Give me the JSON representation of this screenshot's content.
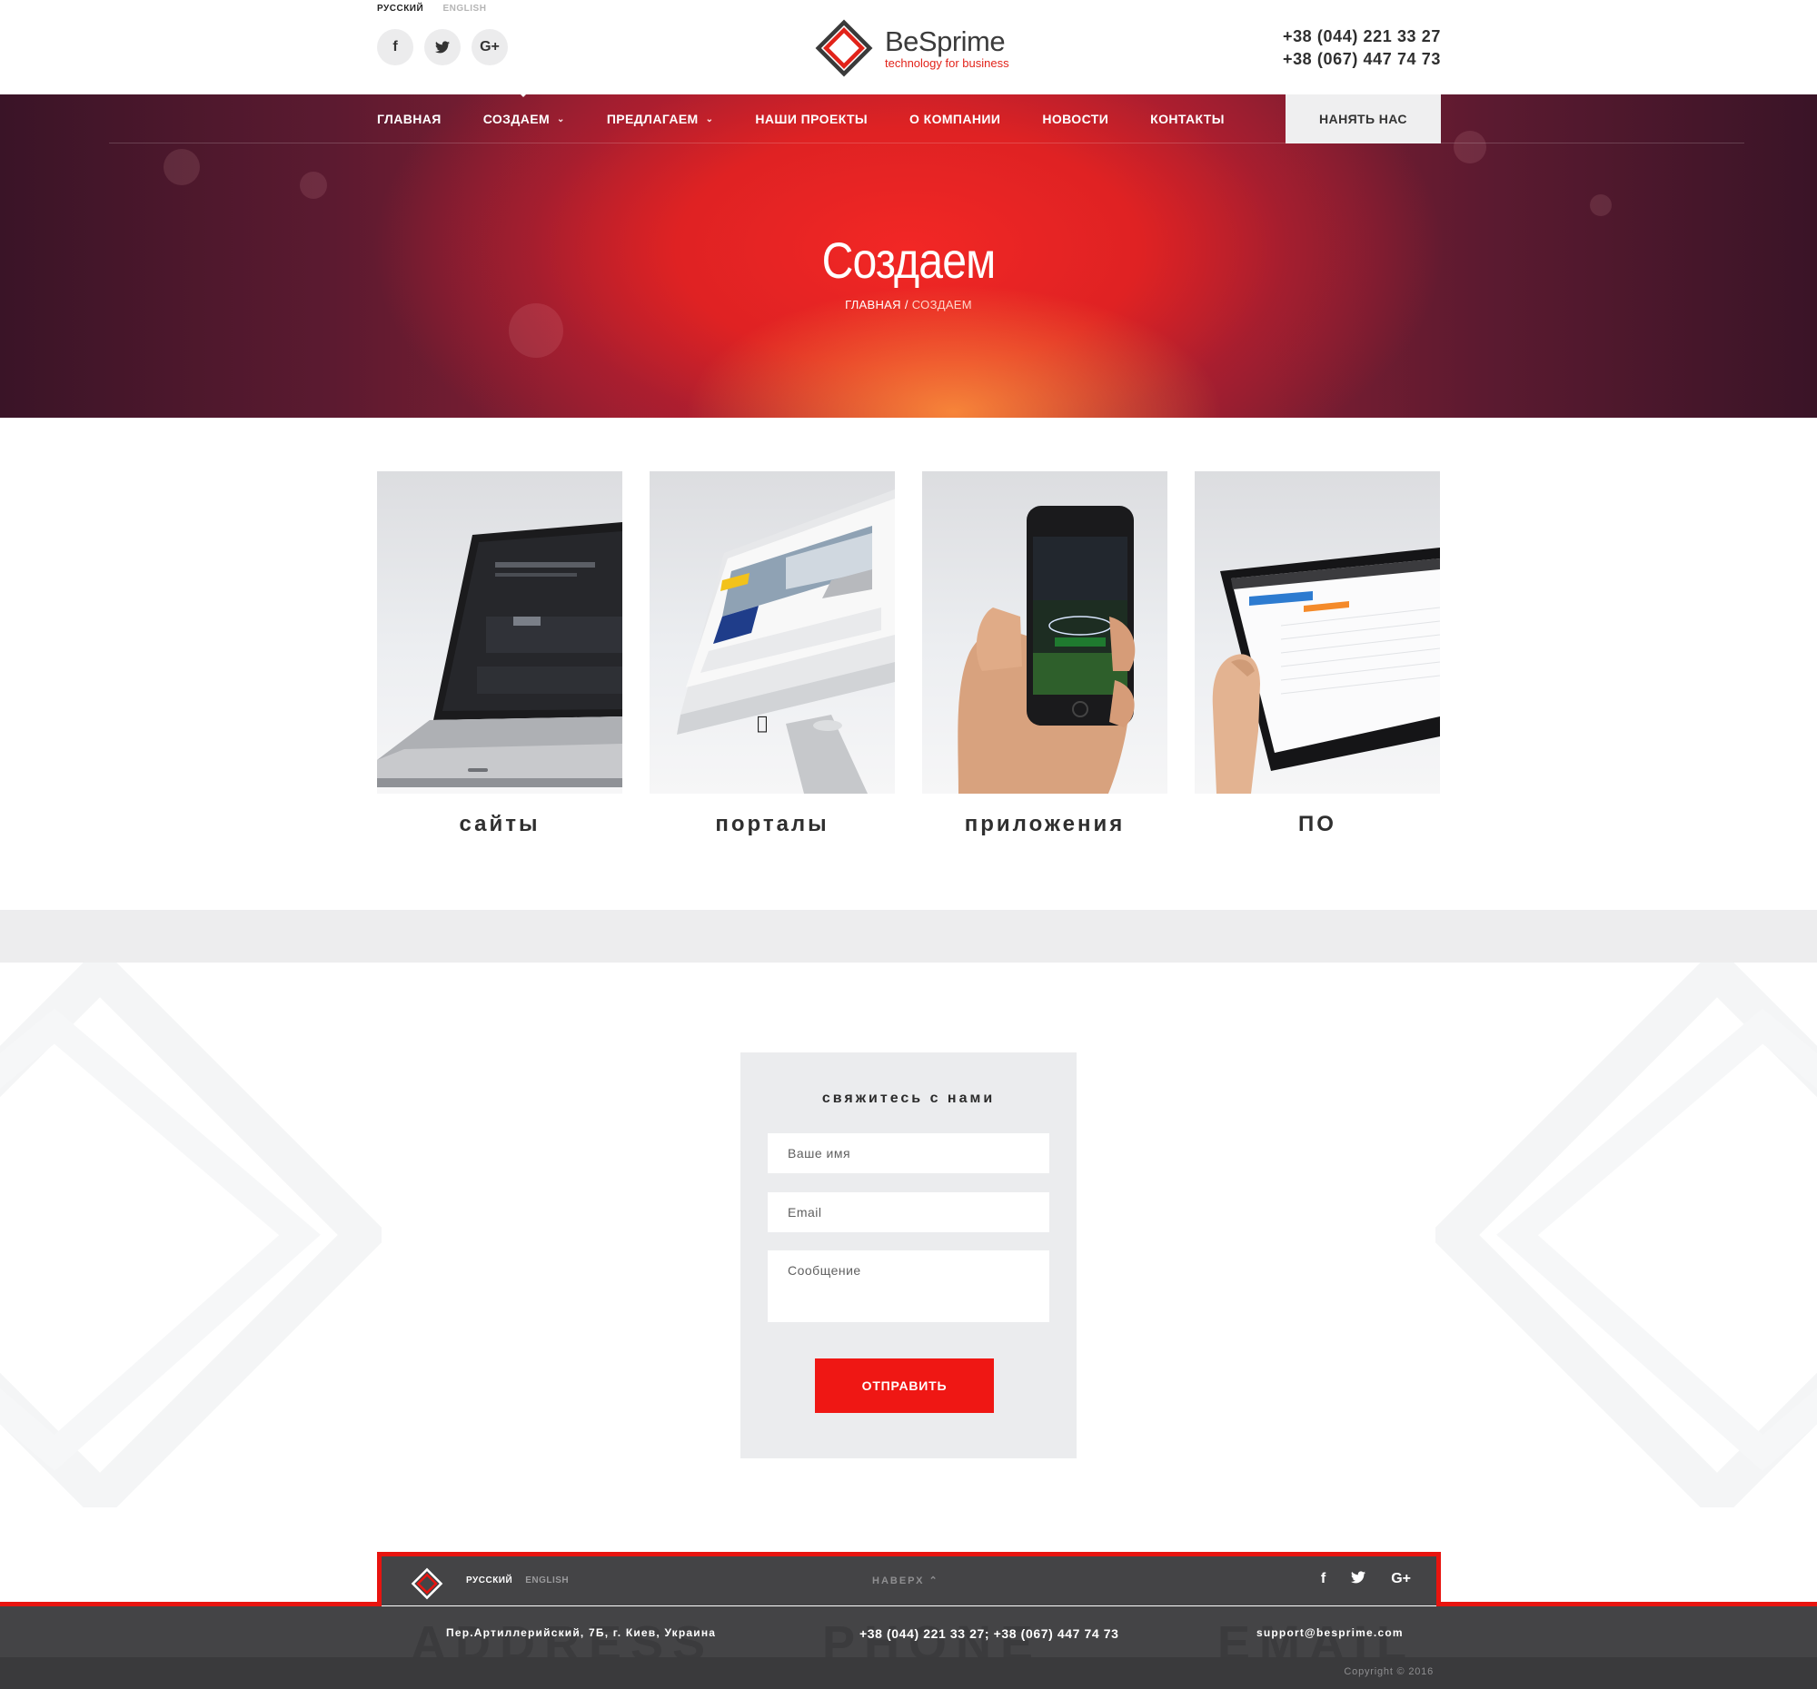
{
  "header": {
    "lang_active": "РУССКИЙ",
    "lang_other": "ENGLISH",
    "social": {
      "facebook": "f",
      "twitter": "twitter-icon",
      "google": "G+"
    },
    "brand_name": "BeSprime",
    "brand_tagline": "technology for business",
    "phone_1": "+38 (044) 221 33 27",
    "phone_2": "+38 (067) 447 74 73"
  },
  "nav": {
    "items": [
      {
        "label": "ГЛАВНАЯ",
        "dropdown": false
      },
      {
        "label": "СОЗДАЕМ",
        "dropdown": true,
        "active": true
      },
      {
        "label": "ПРЕДЛАГАЕМ",
        "dropdown": true
      },
      {
        "label": "НАШИ ПРОЕКТЫ",
        "dropdown": false
      },
      {
        "label": "О КОМПАНИИ",
        "dropdown": false
      },
      {
        "label": "НОВОСТИ",
        "dropdown": false
      },
      {
        "label": "КОНТАКТЫ",
        "dropdown": false
      }
    ],
    "hire_label": "НАНЯТЬ НАС"
  },
  "hero": {
    "title": "Создаем",
    "breadcrumb_home": "ГЛАВНАЯ",
    "breadcrumb_sep": "/",
    "breadcrumb_current": "СОЗДАЕМ"
  },
  "services": [
    {
      "label": "сайты",
      "image": "laptop-mockup"
    },
    {
      "label": "порталы",
      "image": "monitor-mockup"
    },
    {
      "label": "приложения",
      "image": "phone-in-hand-mockup"
    },
    {
      "label": "ПО",
      "image": "tablet-in-hand-mockup"
    }
  ],
  "contact": {
    "title": "свяжитесь с нами",
    "name_placeholder": "Ваше имя",
    "email_placeholder": "Email",
    "message_placeholder": "Сообщение",
    "submit_label": "ОТПРАВИТЬ"
  },
  "footer": {
    "lang_active": "РУССКИЙ",
    "lang_other": "ENGLISH",
    "to_top_label": "НАВЕРХ",
    "address": "Пер.Артиллерийский, 7Б, г. Киев, Украина",
    "phones": "+38 (044) 221 33 27; +38 (067) 447 74 73",
    "email": "support@besprime.com",
    "copyright": "Copyright © 2016"
  },
  "colors": {
    "accent_red": "#e8140f",
    "footer_bg": "#444446",
    "light_grey": "#ededee"
  }
}
